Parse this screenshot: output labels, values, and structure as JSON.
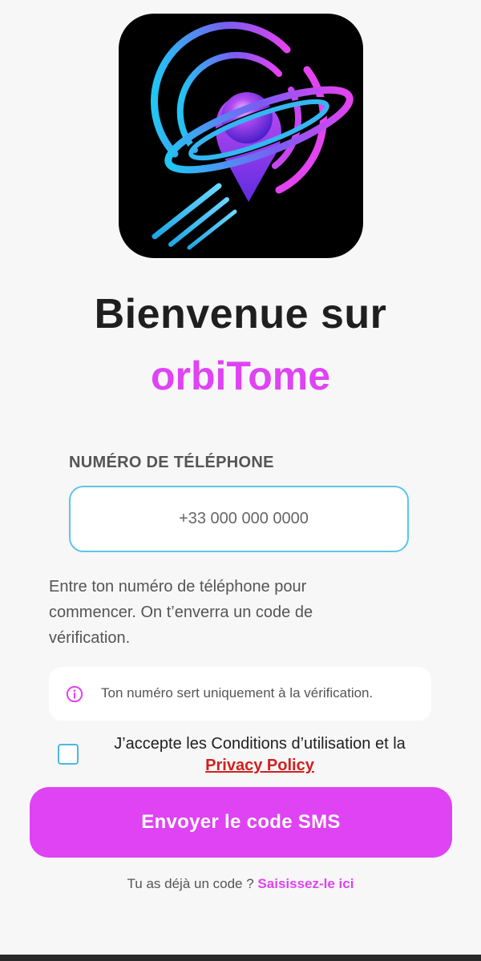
{
  "colors": {
    "accent": "#df43f4",
    "input_border": "#5bc6e8",
    "link_red": "#d11f1f"
  },
  "logo": {
    "icon": "orbit-location-pin-logo"
  },
  "welcome": {
    "line1": "Bienvenue sur",
    "line2": "orbiTome"
  },
  "phone": {
    "label": "NUMÉRO DE TÉLÉPHONE",
    "placeholder": "+33 000 000 0000",
    "value": ""
  },
  "helper_text": "Entre ton numéro de téléphone pour commencer. On t’enverra un code de vérification.",
  "info": {
    "icon": "info-icon",
    "text": "Ton numéro sert uniquement à la vérification."
  },
  "terms": {
    "checked": false,
    "text": "J’accepte les Conditions d’utilisation et la",
    "link": "Privacy Policy"
  },
  "send_button": "Envoyer le code SMS",
  "footer": {
    "question": "Tu as déjà un code ?",
    "link": "Saisissez-le ici"
  }
}
